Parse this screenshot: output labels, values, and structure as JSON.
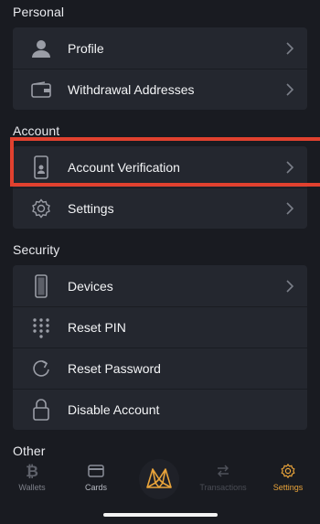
{
  "sections": {
    "personal": "Personal",
    "account": "Account",
    "security": "Security",
    "other": "Other"
  },
  "personal_items": [
    {
      "label": "Profile",
      "icon": "person-icon"
    },
    {
      "label": "Withdrawal Addresses",
      "icon": "wallet-icon"
    }
  ],
  "account_items": [
    {
      "label": "Account Verification",
      "icon": "phone-id-icon"
    },
    {
      "label": "Settings",
      "icon": "gear-icon"
    }
  ],
  "security_items": [
    {
      "label": "Devices",
      "icon": "smartphone-icon"
    },
    {
      "label": "Reset PIN",
      "icon": "keypad-icon"
    },
    {
      "label": "Reset Password",
      "icon": "refresh-icon"
    },
    {
      "label": "Disable Account",
      "icon": "lock-icon"
    }
  ],
  "tabbar": {
    "wallets": "Wallets",
    "cards": "Cards",
    "transactions": "Transactions",
    "settings": "Settings"
  },
  "colors": {
    "background": "#191b21",
    "row": "#24272f",
    "accent": "#e8a33a",
    "highlight": "#e1412f",
    "icon_gray": "#8a8e98"
  }
}
